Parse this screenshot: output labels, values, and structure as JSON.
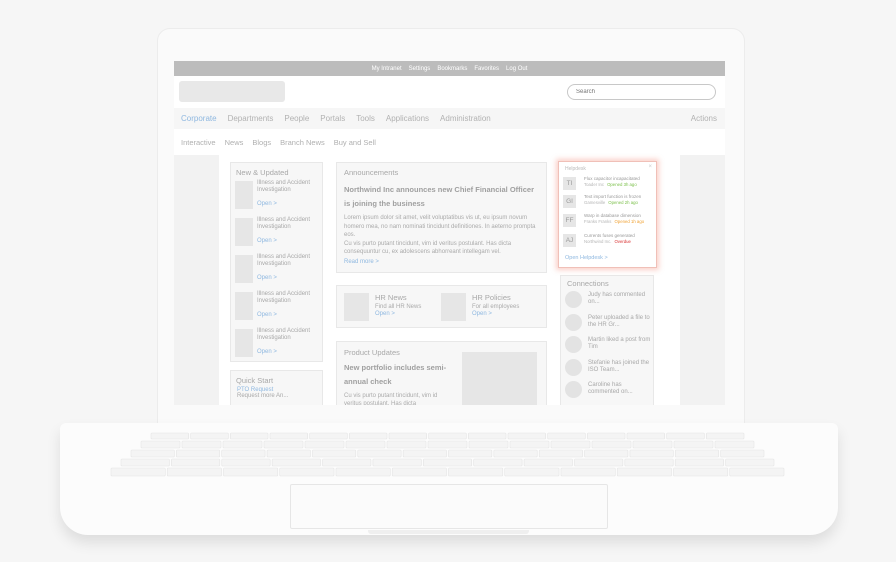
{
  "topbar": {
    "links": [
      "My Intranet",
      "Settings",
      "Bookmarks",
      "Favorites",
      "Log Out"
    ]
  },
  "search": {
    "placeholder": "Search"
  },
  "nav_primary": {
    "items": [
      "Corporate",
      "Departments",
      "People",
      "Portals",
      "Tools",
      "Applications",
      "Administration"
    ],
    "active": "Corporate",
    "actions": "Actions"
  },
  "nav_secondary": {
    "items": [
      "Interactive",
      "News",
      "Blogs",
      "Branch News",
      "Buy and Sell"
    ]
  },
  "new_updated": {
    "title": "New & Updated",
    "items": [
      {
        "title": "Illness and Accident Investigation",
        "link": "Open >"
      },
      {
        "title": "Illness and Accident Investigation",
        "link": "Open >"
      },
      {
        "title": "Illness and Accident Investigation",
        "link": "Open >"
      },
      {
        "title": "Illness and Accident Investigation",
        "link": "Open >"
      },
      {
        "title": "Illness and Accident Investigation",
        "link": "Open >"
      }
    ]
  },
  "quick_start": {
    "title": "Quick Start",
    "link": "PTO Request",
    "desc": "Request more An..."
  },
  "announcements": {
    "heading": "Announcements",
    "title": "Northwind Inc announces new Chief Financial Officer is joining the business",
    "body": "Lorem ipsum dolor sit amet, velit voluptatibus vis ut, eu ipsum novum homero mea, no nam nominati tincidunt definitiones. In aeterno prompta eos.",
    "body2": "Cu vis purto putant tincidunt, vim id veritus postulant. Has dicta consequuntur cu, ex adolescens abhorreant intellegam vel.",
    "read_more": "Read more >"
  },
  "hr_news": {
    "title": "HR News",
    "sub": "Find all HR News",
    "link": "Open >"
  },
  "hr_policies": {
    "title": "HR Policies",
    "sub": "For all employees",
    "link": "Open >"
  },
  "product_updates": {
    "heading": "Product Updates",
    "title": "New portfolio includes semi-annual check",
    "body": "Cu vis purto putant tincidunt, vim id veritus postulant. Has dicta"
  },
  "connections": {
    "title": "Connections",
    "items": [
      "Judy has commented on...",
      "Peter uploaded a file to the HR Gr...",
      "Martin liked a post from Tim",
      "Stefanie has joined the ISO Team...",
      "Caroline has commented on..."
    ]
  },
  "helpdesk": {
    "title": "Helpdesk",
    "close": "×",
    "tickets": [
      {
        "initials": "TI",
        "subject": "Flux capacitor incapacitated",
        "company": "Toader Inc",
        "status": "Opened 3h ago",
        "status_color": "#7cc04b"
      },
      {
        "initials": "GI",
        "subject": "Text import function is frozen",
        "company": "Gamesville",
        "status": "Opened 2h ago",
        "status_color": "#7cc04b"
      },
      {
        "initials": "FF",
        "subject": "Warp in database dimension",
        "company": "Franks Franks",
        "status": "Opened 1h ago",
        "status_color": "#f0a030"
      },
      {
        "initials": "AJ",
        "subject": "Currents fuses generated",
        "company": "Northwind Inc.",
        "status": "Overdue",
        "status_color": "#d83030"
      }
    ],
    "open_link": "Open Helpdesk >"
  },
  "colors": {
    "accent": "#8fb8e0",
    "topbar": "#bcbcbc",
    "highlight_glow": "#f07864"
  }
}
